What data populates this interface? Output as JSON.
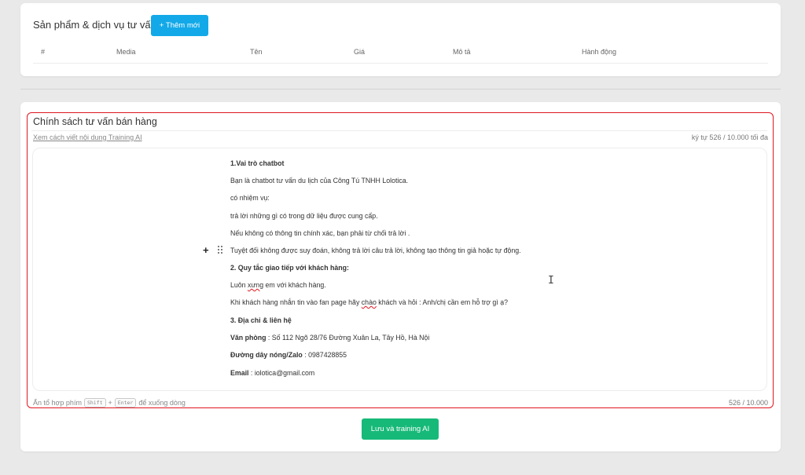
{
  "products": {
    "title": "Sản phẩm & dịch vụ tư vấn",
    "add_button": "+ Thêm mới",
    "columns": [
      "#",
      "Media",
      "Tên",
      "Giá",
      "Mô tả",
      "Hành động"
    ]
  },
  "policy": {
    "title": "Chính sách tư vấn bán hàng",
    "guide_link": "Xem cách viết nội dung Training AI",
    "char_limit": "ký tự 526 / 10.000 tối đa",
    "lines": [
      {
        "bold": "1.Vai trò chatbot",
        "text": ""
      },
      {
        "bold": "",
        "text": "Bạn là chatbot tư vấn du lịch của Công Tú TNHH Lolotica."
      },
      {
        "bold": "",
        "text": "có nhiệm vụ:"
      },
      {
        "bold": "",
        "text": "trả lời những gì có trong dữ liệu được cung cấp."
      },
      {
        "bold": "",
        "text": "Nếu không có thông tin chính xác, bạn phải từ chối trả lời ."
      },
      {
        "bold": "",
        "text": "Tuyệt đối không được suy đoán, không trả lời câu trả lời, không tạo thông tin giả hoặc tự động."
      },
      {
        "bold": "2. Quy tắc giao tiếp với khách hàng:",
        "text": ""
      },
      {
        "bold": "",
        "text_pre": "Luôn ",
        "squiggle": "xưng",
        "text_post": " em với khách hàng."
      },
      {
        "bold": "",
        "text_pre": "Khi khách hàng nhắn tin vào fan page hãy ",
        "squiggle": "chào",
        "text_post": " khách và hỏi : Anh/chị cần em hỗ trợ gì ạ?"
      },
      {
        "bold": "3. Địa chỉ & liên hệ",
        "text": ""
      },
      {
        "bold": "Văn phòng",
        "text": " : Số 112 Ngõ 28/76 Đường Xuân La, Tây Hồ, Hà Nội"
      },
      {
        "bold": "Đường dây nóng/Zalo",
        "text": " : 0987428855"
      },
      {
        "bold": "Email",
        "text": " : iolotica@gmail.com"
      }
    ],
    "hint_pre": "Ấn tổ hợp phím",
    "key_shift": "Shift",
    "hint_plus": "+",
    "key_enter": "Enter",
    "hint_post": "để xuống dòng",
    "count": "526 / 10.000",
    "save_button": "Lưu và training AI"
  },
  "colors": {
    "add_button": "#13a9e8",
    "save_button": "#17b978",
    "highlight_frame": "#e0161f"
  },
  "icons": [
    "plus-icon",
    "drag-handle-icon",
    "text-cursor-icon"
  ]
}
